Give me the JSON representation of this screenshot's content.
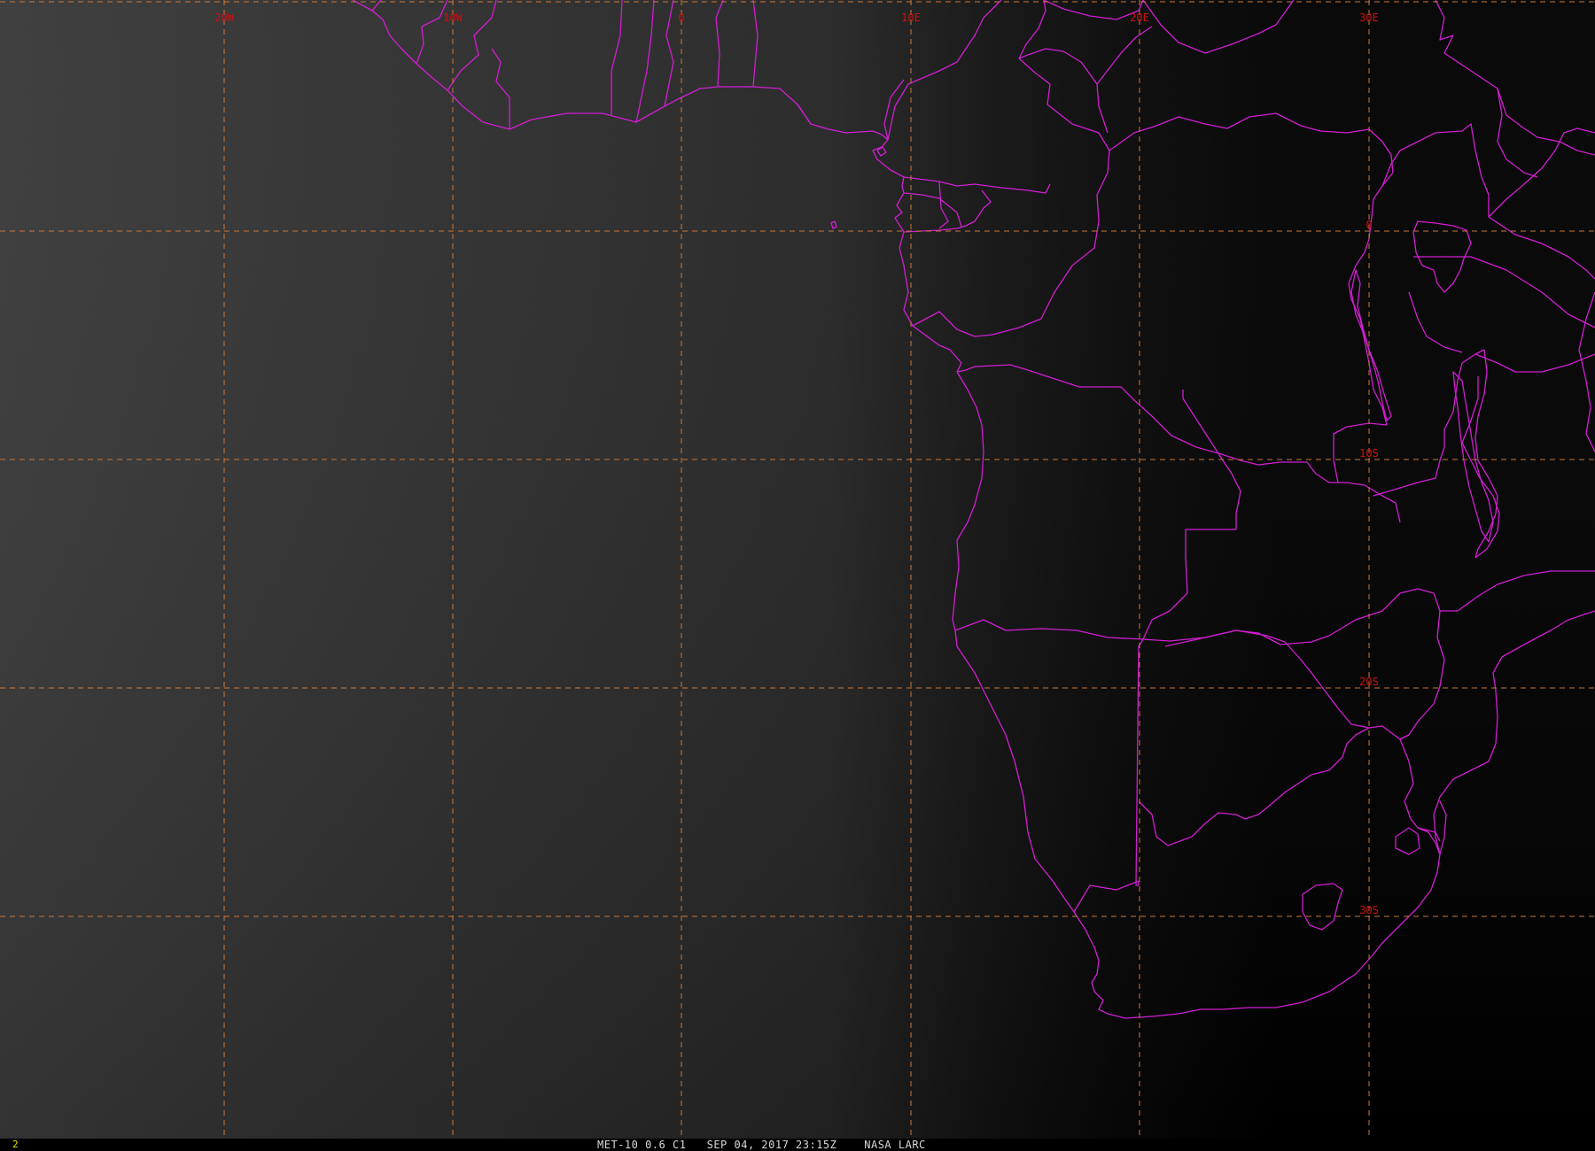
{
  "map": {
    "colors": {
      "gridline": "#c8783c",
      "grid_label": "#cc1010",
      "border": "#d21ed2",
      "ocean_dark": "#2e2e2e",
      "night": "#000000"
    },
    "longitude_labels": [
      "20W",
      "10W",
      "0",
      "10E",
      "20E",
      "30E"
    ],
    "latitude_labels": [
      "0",
      "10S",
      "20S",
      "30S"
    ]
  },
  "status_bar": {
    "frame_number": "2",
    "caption": "MET-10 0.6 C1   SEP 04, 2017 23:15Z    NASA LARC"
  }
}
